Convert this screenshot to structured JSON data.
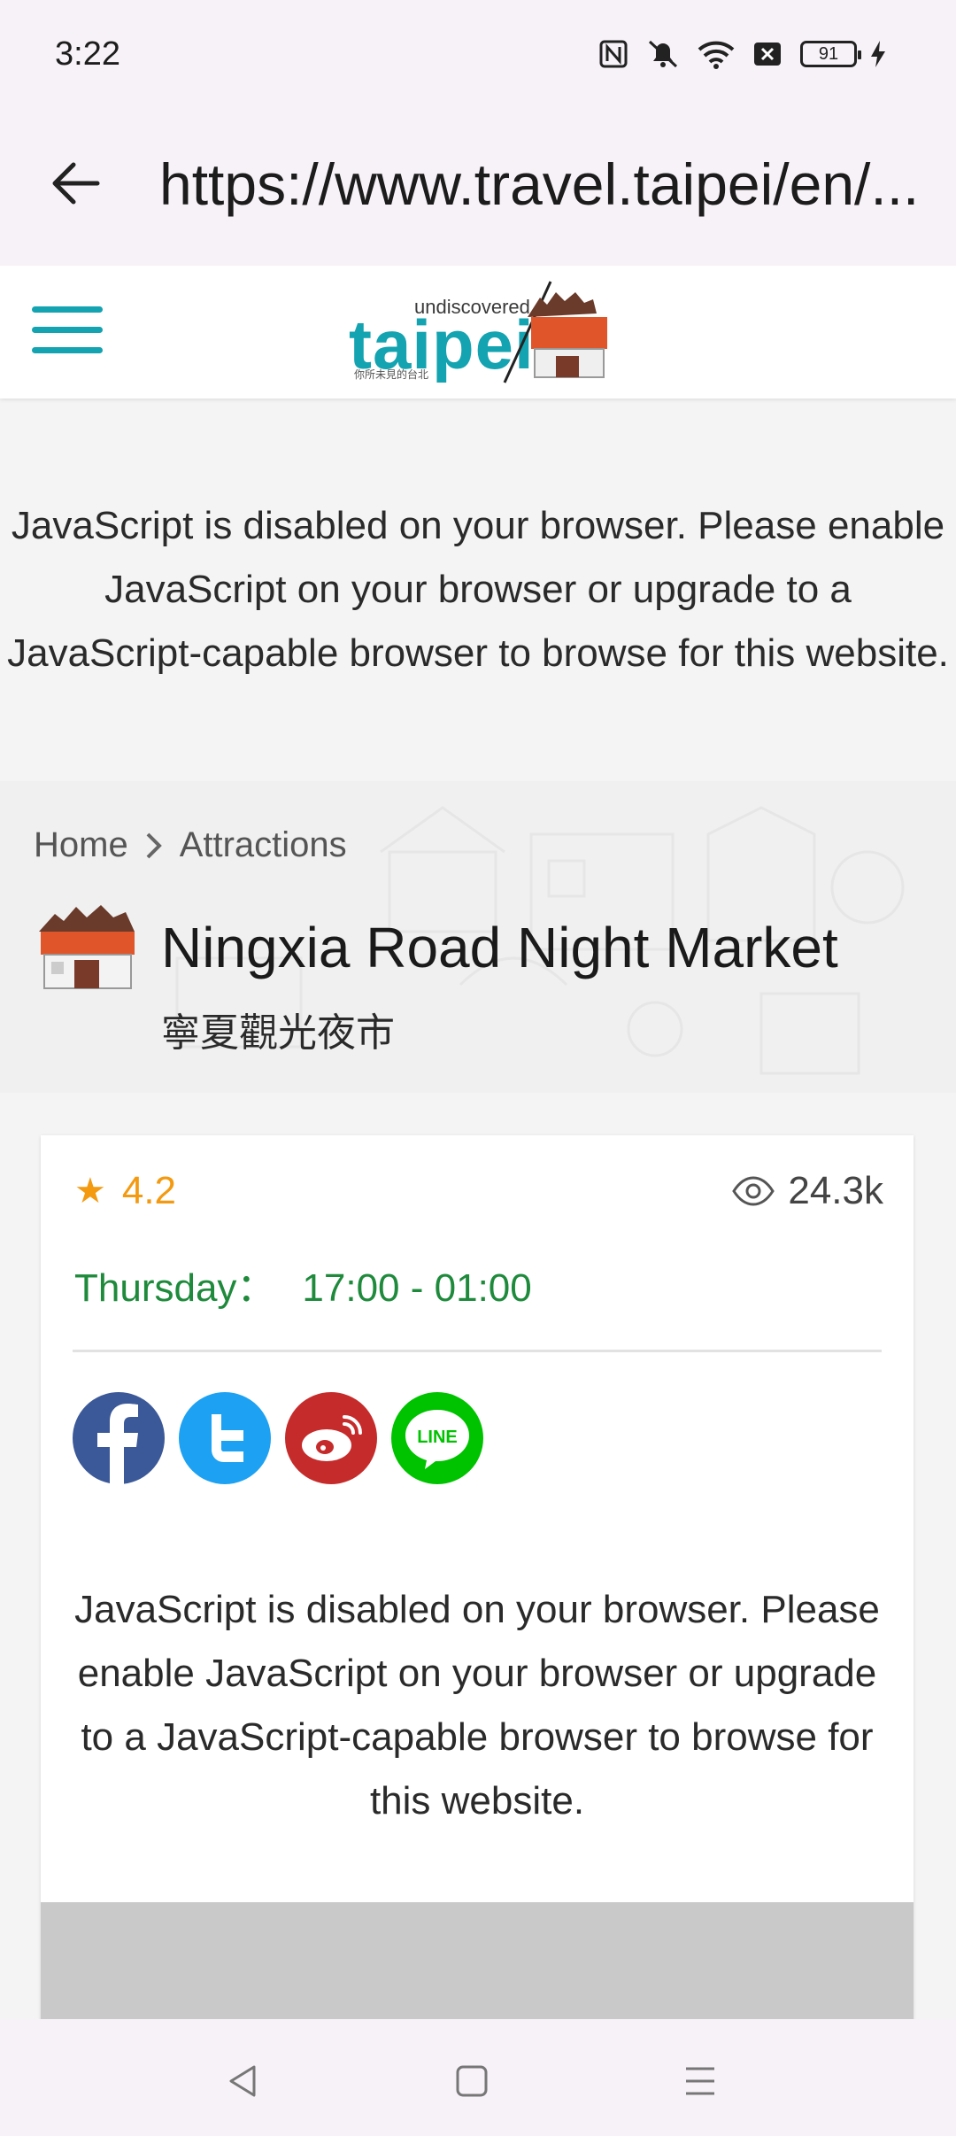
{
  "status": {
    "time": "3:22",
    "battery": "91"
  },
  "browser": {
    "url": "https://www.travel.taipei/en/..."
  },
  "site": {
    "logo_text_small": "undiscovered",
    "logo_text_big": "taipei",
    "logo_text_tiny": "你所未見的台北"
  },
  "js_notice": "JavaScript is disabled on your browser. Please enable JavaScript on your browser or upgrade to a JavaScript-capable browser to browse for this website.",
  "breadcrumb": {
    "home": "Home",
    "current": "Attractions"
  },
  "attraction": {
    "title": "Ningxia Road Night Market",
    "subtitle": "寧夏觀光夜市",
    "rating": "4.2",
    "views": "24.3k",
    "hours_day": "Thursday：",
    "hours_time": "17:00 - 01:00"
  },
  "social": {
    "line_label": "LINE"
  },
  "card_notice": "JavaScript is disabled on your browser. Please enable JavaScript on your browser or upgrade to a JavaScript-capable browser to browse for this website.",
  "icons": [
    "back-arrow-icon",
    "hamburger-menu-icon",
    "star-icon",
    "eye-icon",
    "facebook-icon",
    "twitter-icon",
    "weibo-icon",
    "line-icon",
    "nav-back-icon",
    "nav-home-icon",
    "nav-menu-icon"
  ],
  "colors": {
    "accent_teal": "#14a3b0",
    "rating_orange": "#f39a11",
    "hours_green": "#1e8a3b",
    "facebook": "#3b5998",
    "twitter": "#1da1f2",
    "weibo": "#c62b2b",
    "line": "#00c300"
  }
}
